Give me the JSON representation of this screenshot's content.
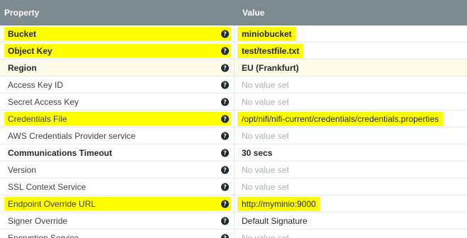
{
  "header": {
    "property": "Property",
    "value": "Value"
  },
  "rows": [
    {
      "name": "Bucket",
      "value": "miniobucket",
      "required": true,
      "highlight_name": true,
      "highlight_value": true,
      "value_set": true
    },
    {
      "name": "Object Key",
      "value": "test/testfile.txt",
      "required": true,
      "highlight_name": true,
      "highlight_value": true,
      "value_set": true
    },
    {
      "name": "Region",
      "value": "EU (Frankfurt)",
      "required": true,
      "highlight_name": false,
      "highlight_value": false,
      "value_set": true
    },
    {
      "name": "Access Key ID",
      "value": "No value set",
      "required": false,
      "highlight_name": false,
      "highlight_value": false,
      "value_set": false
    },
    {
      "name": "Secret Access Key",
      "value": "No value set",
      "required": false,
      "highlight_name": false,
      "highlight_value": false,
      "value_set": false
    },
    {
      "name": "Credentials File",
      "value": "/opt/nifi/nifi-current/credentials/credentials.properties",
      "required": false,
      "highlight_name": true,
      "highlight_value": true,
      "value_set": true
    },
    {
      "name": "AWS Credentials Provider service",
      "value": "No value set",
      "required": false,
      "highlight_name": false,
      "highlight_value": false,
      "value_set": false
    },
    {
      "name": "Communications Timeout",
      "value": "30 secs",
      "required": true,
      "highlight_name": false,
      "highlight_value": false,
      "value_set": true
    },
    {
      "name": "Version",
      "value": "No value set",
      "required": false,
      "highlight_name": false,
      "highlight_value": false,
      "value_set": false
    },
    {
      "name": "SSL Context Service",
      "value": "No value set",
      "required": false,
      "highlight_name": false,
      "highlight_value": false,
      "value_set": false
    },
    {
      "name": "Endpoint Override URL",
      "value": "http://myminio:9000",
      "required": false,
      "highlight_name": true,
      "highlight_value": true,
      "value_set": true
    },
    {
      "name": "Signer Override",
      "value": "Default Signature",
      "required": false,
      "highlight_name": false,
      "highlight_value": false,
      "value_set": true
    },
    {
      "name": "Encryption Service",
      "value": "No value set",
      "required": false,
      "highlight_name": false,
      "highlight_value": false,
      "value_set": false
    }
  ],
  "icons": {
    "help": "help-question-icon"
  },
  "colors": {
    "header_bg": "#7d8a8f",
    "highlight": "#ffff00",
    "unset_text": "#a8b1b5"
  }
}
